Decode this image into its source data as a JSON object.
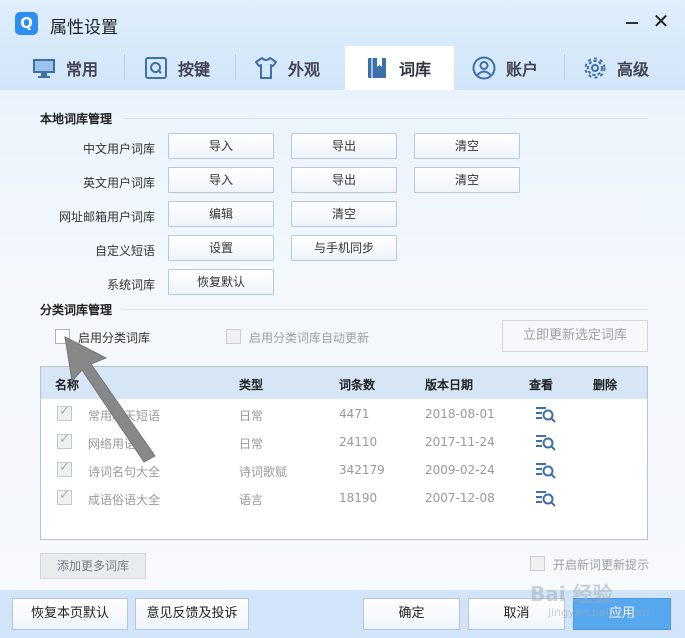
{
  "window": {
    "title": "属性设置",
    "logo_text": "Q",
    "minimize": "—",
    "close": "✕"
  },
  "tabs": [
    {
      "label": "常用",
      "icon": "monitor-icon"
    },
    {
      "label": "按键",
      "icon": "key-q-icon"
    },
    {
      "label": "外观",
      "icon": "tshirt-icon"
    },
    {
      "label": "词库",
      "icon": "book-icon",
      "active": true
    },
    {
      "label": "账户",
      "icon": "user-icon"
    },
    {
      "label": "高级",
      "icon": "gear-icon"
    }
  ],
  "local": {
    "title": "本地词库管理",
    "rows": [
      {
        "label": "中文用户词库",
        "buttons": [
          "导入",
          "导出",
          "清空"
        ]
      },
      {
        "label": "英文用户词库",
        "buttons": [
          "导入",
          "导出",
          "清空"
        ]
      },
      {
        "label": "网址邮箱用户词库",
        "buttons": [
          "编辑",
          "清空"
        ]
      },
      {
        "label": "自定义短语",
        "buttons": [
          "设置",
          "与手机同步"
        ]
      },
      {
        "label": "系统词库",
        "buttons": [
          "恢复默认"
        ]
      }
    ]
  },
  "category": {
    "title": "分类词库管理",
    "enable_label": "启用分类词库",
    "auto_update_label": "启用分类词库自动更新",
    "update_button": "立即更新选定词库",
    "headers": {
      "name": "名称",
      "type": "类型",
      "count": "词条数",
      "date": "版本日期",
      "view": "查看",
      "delete": "删除"
    },
    "rows": [
      {
        "name": "常用聊天短语",
        "type": "日常",
        "count": "4471",
        "date": "2018-08-01"
      },
      {
        "name": "网络用语",
        "type": "日常",
        "count": "24110",
        "date": "2017-11-24"
      },
      {
        "name": "诗词名句大全",
        "type": "诗词歌赋",
        "count": "342179",
        "date": "2009-02-24"
      },
      {
        "name": "成语俗语大全",
        "type": "语言",
        "count": "18190",
        "date": "2007-12-08"
      }
    ],
    "add_more": "添加更多词库",
    "new_word_hint": "开启新词更新提示"
  },
  "footer": {
    "restore": "恢复本页默认",
    "feedback": "意见反馈及投诉",
    "ok": "确定",
    "cancel": "取消",
    "apply": "应用"
  },
  "watermark": {
    "main": "Bai 经验",
    "sub": "jingyan.baidu.com"
  }
}
